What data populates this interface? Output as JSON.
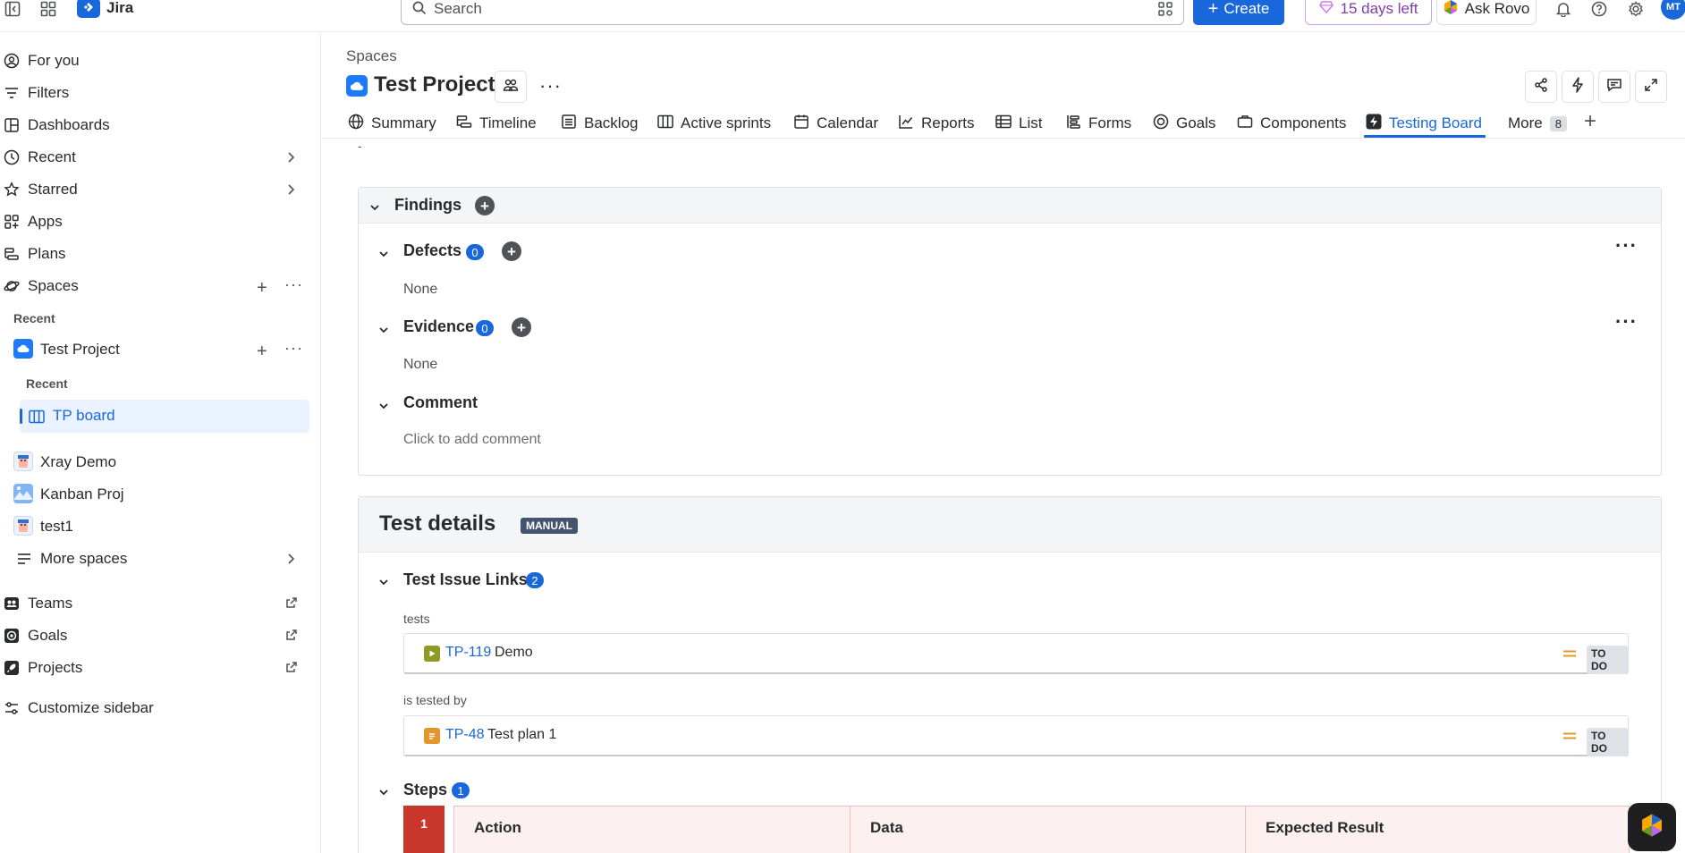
{
  "app": {
    "name": "Jira",
    "search_placeholder": "Search",
    "create_label": "Create",
    "trial_label": "15 days left",
    "rovo_label": "Ask Rovo",
    "avatar_initials": "MT"
  },
  "sidebar": {
    "items": [
      {
        "label": "For you",
        "icon": "user-circle-icon"
      },
      {
        "label": "Filters",
        "icon": "filter-icon"
      },
      {
        "label": "Dashboards",
        "icon": "dashboard-icon"
      },
      {
        "label": "Recent",
        "icon": "clock-icon"
      },
      {
        "label": "Starred",
        "icon": "star-icon"
      },
      {
        "label": "Apps",
        "icon": "apps-icon"
      },
      {
        "label": "Plans",
        "icon": "plans-icon"
      },
      {
        "label": "Spaces",
        "icon": "spaces-icon"
      }
    ],
    "recent_heading": "Recent",
    "project_label": "Test Project",
    "project_recent_heading": "Recent",
    "board_label": "TP board",
    "other_projects": [
      "Xray Demo",
      "Kanban Proj",
      "test1"
    ],
    "more_spaces": "More spaces",
    "external": [
      {
        "label": "Teams",
        "icon": "teams-icon"
      },
      {
        "label": "Goals",
        "icon": "goal-icon"
      },
      {
        "label": "Projects",
        "icon": "rocket-icon"
      }
    ],
    "customize": "Customize sidebar"
  },
  "header": {
    "breadcrumb": "Spaces",
    "project_title": "Test Project"
  },
  "tabs": [
    {
      "label": "Summary",
      "icon": "globe-icon"
    },
    {
      "label": "Timeline",
      "icon": "timeline-icon"
    },
    {
      "label": "Backlog",
      "icon": "backlog-icon"
    },
    {
      "label": "Active sprints",
      "icon": "board-icon"
    },
    {
      "label": "Calendar",
      "icon": "calendar-icon"
    },
    {
      "label": "Reports",
      "icon": "chart-line-icon"
    },
    {
      "label": "List",
      "icon": "list-icon"
    },
    {
      "label": "Forms",
      "icon": "forms-icon"
    },
    {
      "label": "Goals",
      "icon": "goal-icon"
    },
    {
      "label": "Components",
      "icon": "components-icon"
    },
    {
      "label": "Testing Board",
      "icon": "lightning-icon",
      "active": true
    }
  ],
  "tabs_more": {
    "label": "More",
    "count": "8"
  },
  "content": {
    "dash": "-",
    "findings": {
      "title": "Findings",
      "defects_title": "Defects",
      "defects_count": "0",
      "defects_empty": "None",
      "evidence_title": "Evidence",
      "evidence_count": "0",
      "evidence_empty": "None",
      "comment_title": "Comment",
      "comment_placeholder": "Click to add comment"
    },
    "test_details": {
      "title": "Test details",
      "type_badge": "MANUAL",
      "links_title": "Test Issue Links",
      "links_count": "2",
      "groups": [
        {
          "relation": "tests",
          "key": "TP-119",
          "summary": "Demo",
          "status": "TO DO",
          "type_color": "#6a9a23"
        },
        {
          "relation": "is tested by",
          "key": "TP-48",
          "summary": "Test plan 1",
          "status": "TO DO",
          "type_color": "#e2962b"
        }
      ],
      "steps_title": "Steps",
      "steps_count": "1",
      "step_number": "1",
      "columns": [
        "Action",
        "Data",
        "Expected Result"
      ]
    }
  },
  "colors": {
    "accent": "#1868db",
    "priority_medium": "#e2962b",
    "step_red": "#c9372c"
  }
}
